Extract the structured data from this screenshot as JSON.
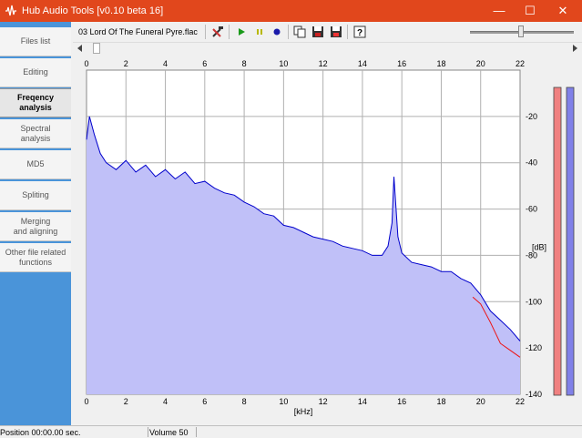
{
  "window": {
    "title": "Hub Audio Tools [v0.10 beta 16]",
    "minimize_glyph": "—",
    "maximize_glyph": "☐",
    "close_glyph": "✕",
    "accent": "#e1471c"
  },
  "sidebar": {
    "items": [
      {
        "label": "Files list",
        "active": false
      },
      {
        "label": "Editing",
        "active": false
      },
      {
        "label": "Freqency\nanalysis",
        "active": true
      },
      {
        "label": "Spectral\nanalysis",
        "active": false
      },
      {
        "label": "MD5",
        "active": false
      },
      {
        "label": "Spliting",
        "active": false
      },
      {
        "label": "Merging\nand aligning",
        "active": false
      },
      {
        "label": "Other file related\nfunctions",
        "active": false
      }
    ],
    "background": "#4a94d9"
  },
  "toolbar": {
    "filename": "03 Lord Of The Funeral Pyre.flac",
    "icons": [
      "tools-icon",
      "play-icon",
      "pause-icon",
      "stop-icon",
      "copy-icon",
      "save-icon",
      "save-as-icon",
      "help-icon"
    ],
    "play_symbol": "▶",
    "pause_symbol": "⏸",
    "stop_symbol": "●",
    "help_symbol": "?"
  },
  "statusbar": {
    "position": "Position 00:00.00 sec.",
    "volume": "Volume 50"
  },
  "chart_data": {
    "type": "line",
    "xlabel": "[kHz]",
    "ylabel": "[dB]",
    "xlim": [
      0,
      22
    ],
    "ylim": [
      -140,
      0
    ],
    "x_ticks": [
      "0",
      "2",
      "4",
      "6",
      "8",
      "10",
      "12",
      "14",
      "16",
      "18",
      "20",
      "22"
    ],
    "y_ticks": [
      "-20",
      "-40",
      "-60",
      "-80",
      "-100",
      "-120",
      "-140"
    ],
    "grid": true,
    "series": [
      {
        "color": "#0000cc",
        "fill": "#c0c0f8",
        "x": [
          0,
          0.15,
          0.4,
          0.7,
          1,
          1.5,
          2,
          2.5,
          3,
          3.5,
          4,
          4.5,
          5,
          5.5,
          6,
          6.5,
          7,
          7.5,
          8,
          8.5,
          9,
          9.5,
          10,
          10.5,
          11,
          11.5,
          12,
          12.5,
          13,
          13.5,
          14,
          14.5,
          15,
          15.3,
          15.5,
          15.6,
          15.8,
          16,
          16.5,
          17,
          17.5,
          18,
          18.5,
          19,
          19.5,
          20,
          20.5,
          21,
          21.5,
          22
        ],
        "y": [
          -30,
          -20,
          -28,
          -36,
          -40,
          -43,
          -39,
          -44,
          -41,
          -46,
          -43,
          -47,
          -44,
          -49,
          -48,
          -51,
          -53,
          -54,
          -57,
          -59,
          -62,
          -63,
          -67,
          -68,
          -70,
          -72,
          -73,
          -74,
          -76,
          -77,
          -78,
          -80,
          -80,
          -76,
          -66,
          -46,
          -72,
          -79,
          -83,
          -84,
          -85,
          -87,
          -87,
          -90,
          -92,
          -97,
          -104,
          -108,
          -112,
          -117
        ]
      },
      {
        "color": "#ee1111",
        "x": [
          19.6,
          20,
          20.5,
          21,
          21.5,
          22
        ],
        "y": [
          -98,
          -101,
          -109,
          -118,
          -121,
          -124
        ]
      }
    ],
    "meters": [
      {
        "color": "#f08080",
        "level_db": -140
      },
      {
        "color": "#8080e8",
        "level_db": -140
      }
    ]
  }
}
